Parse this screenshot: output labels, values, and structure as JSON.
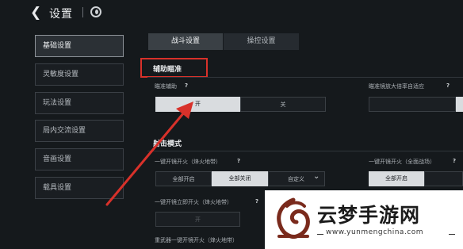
{
  "header": {
    "back_glyph": "❮",
    "title": "设置",
    "logo_icon": "game-logo-icon"
  },
  "sidebar": {
    "items": [
      {
        "label": "基础设置",
        "active": true
      },
      {
        "label": "灵敏度设置",
        "active": false
      },
      {
        "label": "玩法设置",
        "active": false
      },
      {
        "label": "局内交流设置",
        "active": false
      },
      {
        "label": "音画设置",
        "active": false
      },
      {
        "label": "载具设置",
        "active": false
      }
    ]
  },
  "tabs": [
    {
      "label": "战斗设置",
      "active": true
    },
    {
      "label": "操控设置",
      "active": false
    }
  ],
  "aim_assist": {
    "section_title": "辅助瞄准",
    "aim_assist_label": "瞄准辅助",
    "aim_assist_on": "开",
    "aim_assist_off": "关",
    "scope_adapt_label": "瞄准镜放大倍率自适应"
  },
  "fire_mode": {
    "section_title": "射击模式",
    "one_key_label": "一键开镜开火（烽火地带）",
    "one_key_options": [
      "全部开启",
      "全部关闭",
      "自定义"
    ],
    "one_key_selected": "全部关闭",
    "one_key_right_label": "一键开镜开火（全面战场）",
    "one_key_right_options": [
      "全部开启"
    ],
    "instant_fire_label": "一键开镜立即开火（烽火地带）",
    "instant_fire_on": "开",
    "heavy_label": "重武器一键开镜开火（烽火地带）"
  },
  "help_glyph": "?",
  "dropdown_glyph": "⌄",
  "watermark": {
    "name": "云梦手游网",
    "url": "www.yunmengchina.com"
  },
  "colors": {
    "highlight_red": "#d8312a",
    "background": "#15191c",
    "selected": "#d9dcdf"
  }
}
